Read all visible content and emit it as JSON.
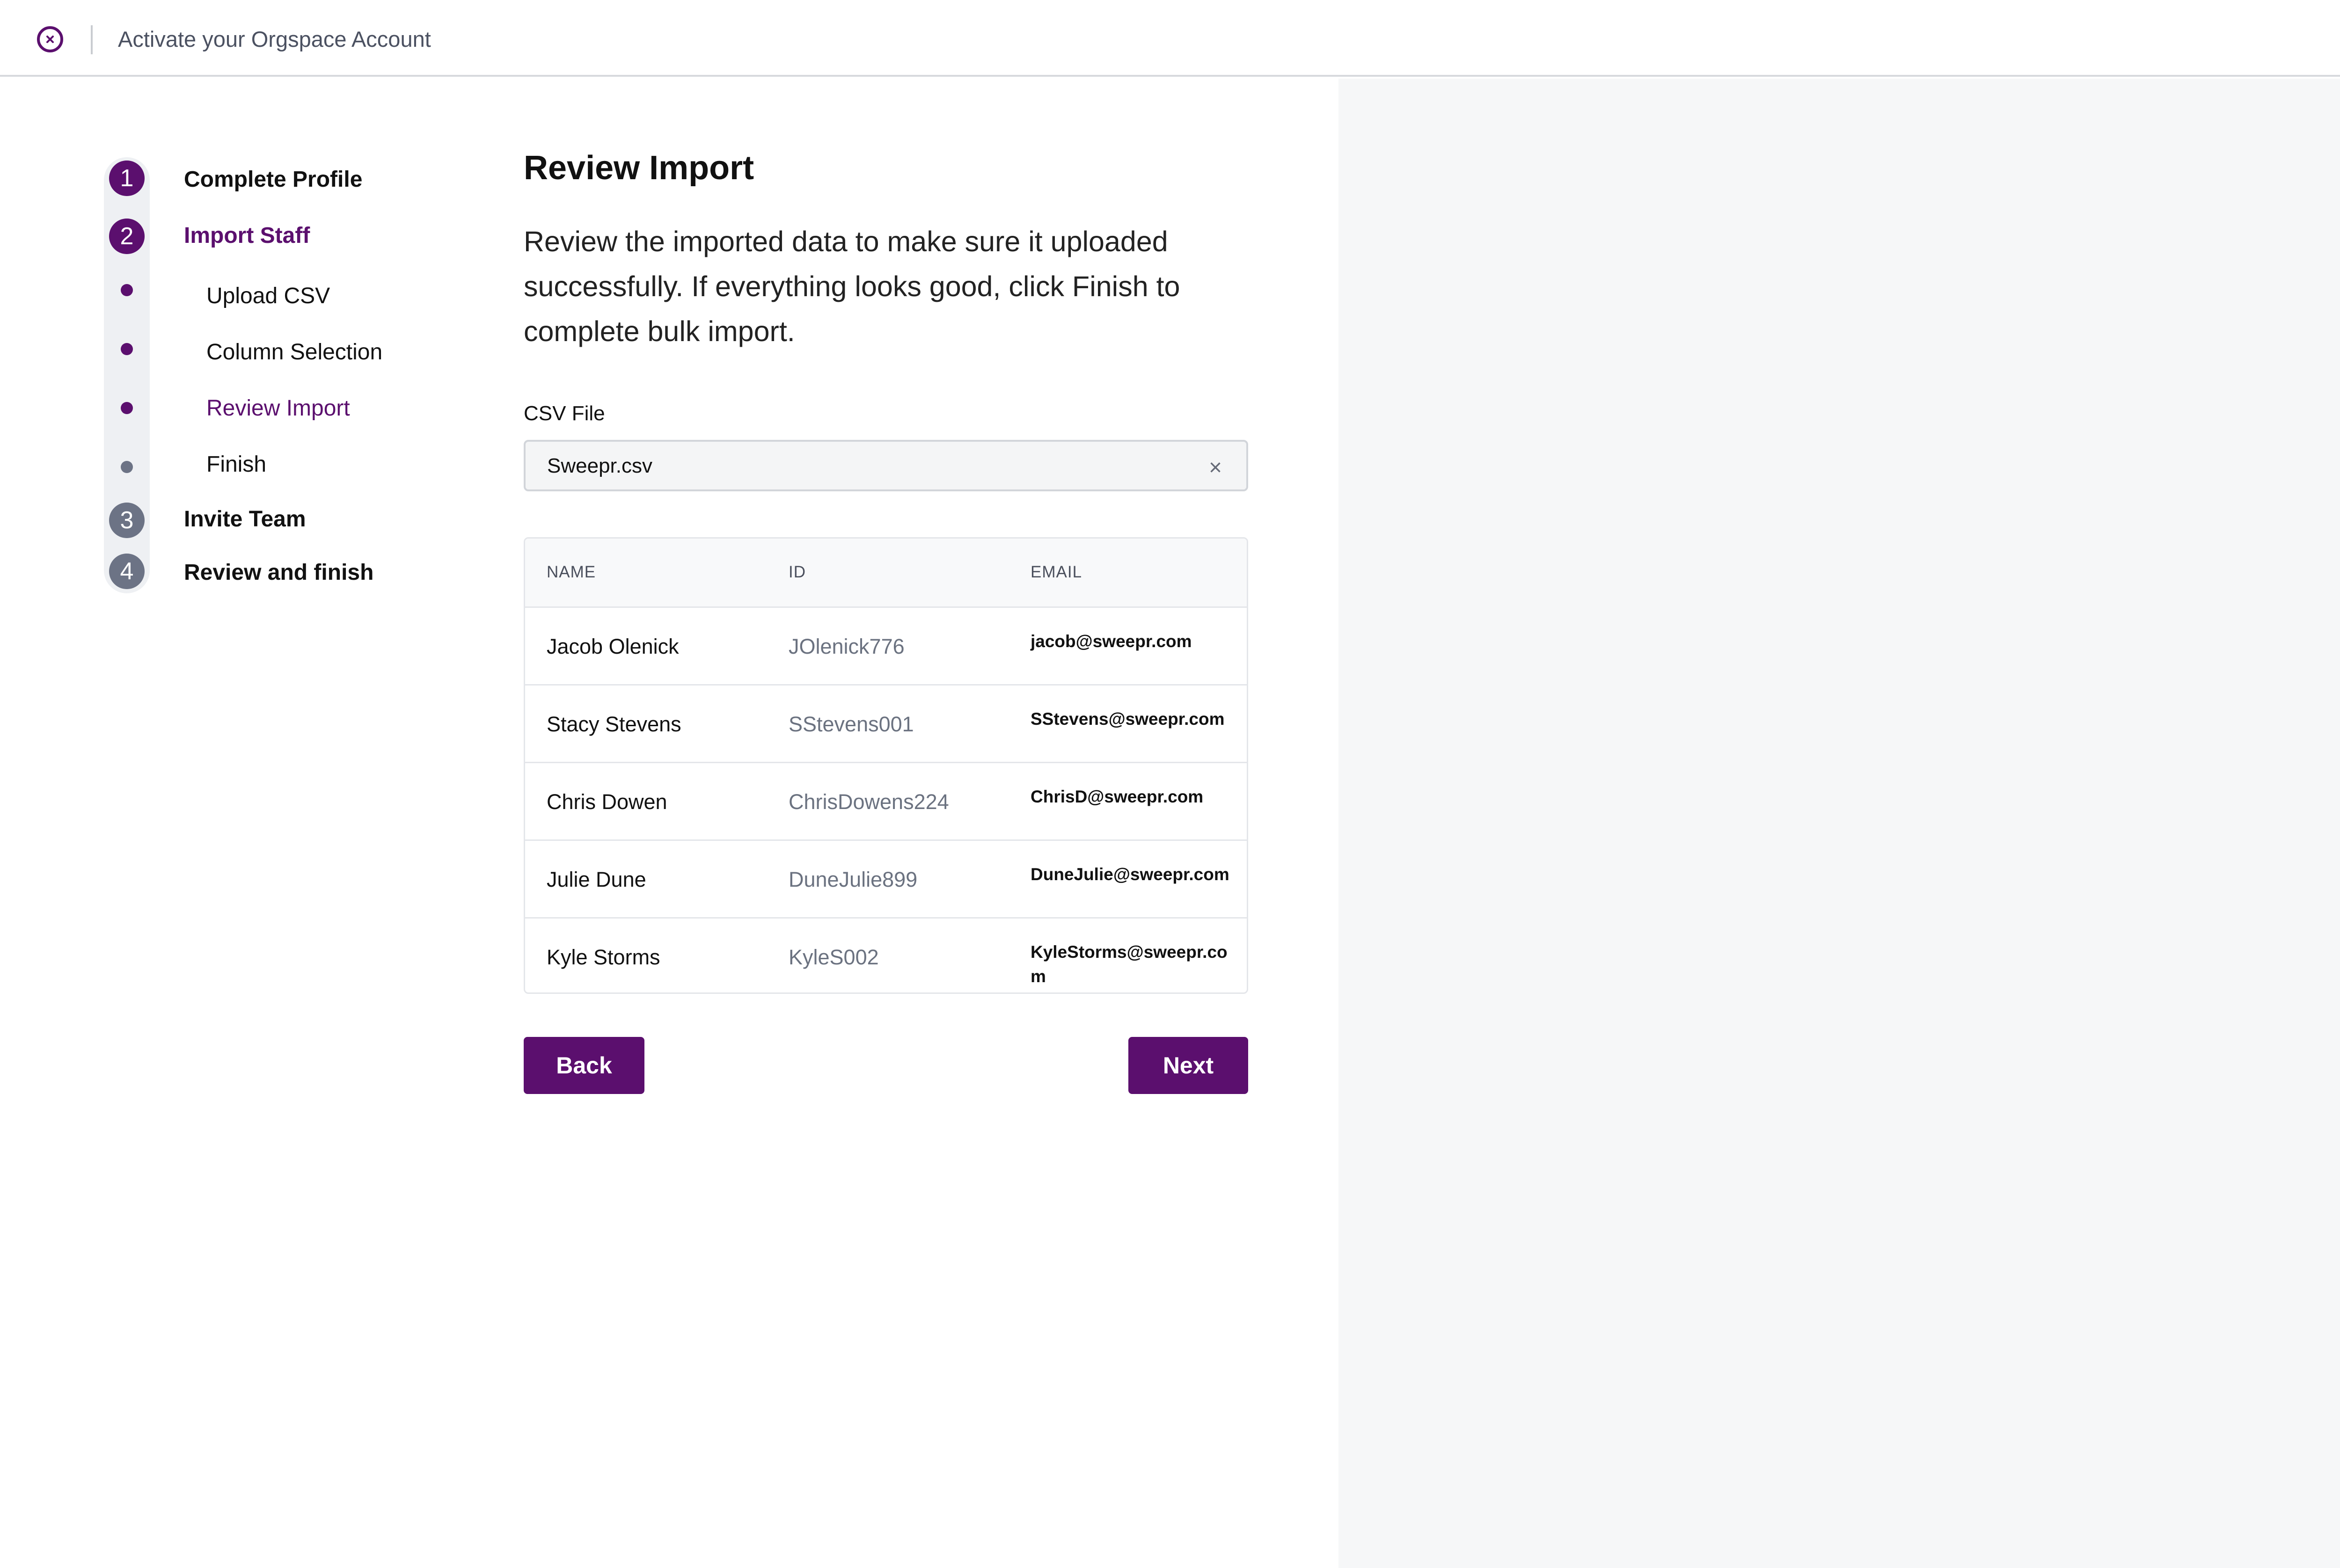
{
  "header": {
    "title": "Activate your Orgspace Account",
    "close_icon": "close-circle-icon"
  },
  "steps": [
    {
      "number": "1",
      "label": "Complete Profile",
      "state": "complete"
    },
    {
      "number": "2",
      "label": "Import Staff",
      "state": "current",
      "substeps": [
        {
          "label": "Upload CSV",
          "state": "complete"
        },
        {
          "label": "Column Selection",
          "state": "complete"
        },
        {
          "label": "Review Import",
          "state": "current"
        },
        {
          "label": "Finish",
          "state": "upcoming"
        }
      ]
    },
    {
      "number": "3",
      "label": "Invite Team",
      "state": "upcoming"
    },
    {
      "number": "4",
      "label": "Review and finish",
      "state": "upcoming"
    }
  ],
  "main": {
    "heading": "Review Import",
    "description": "Review the imported data to make sure it uploaded successfully. If everything looks good, click Finish to complete bulk import.",
    "csv_label": "CSV File",
    "csv_value": "Sweepr.csv",
    "clear_icon": "close-icon"
  },
  "table": {
    "columns": [
      "NAME",
      "ID",
      "EMAIL"
    ],
    "rows": [
      {
        "name": "Jacob Olenick",
        "id": "JOlenick776",
        "email": "jacob@sweepr.com"
      },
      {
        "name": "Stacy Stevens",
        "id": "SStevens001",
        "email": "SStevens@sweepr.com"
      },
      {
        "name": "Chris Dowen",
        "id": "ChrisDowens224",
        "email": "ChrisD@sweepr.com"
      },
      {
        "name": "Julie Dune",
        "id": "DuneJulie899",
        "email": "DuneJulie@sweepr.com"
      },
      {
        "name": "Kyle Storms",
        "id": "KyleS002",
        "email": "KyleStorms@sweepr.com"
      }
    ]
  },
  "buttons": {
    "back": "Back",
    "next": "Next"
  },
  "colors": {
    "accent": "#5b0f6e",
    "inactive_step": "#6c7385",
    "right_panel": "#f6f7f8"
  }
}
